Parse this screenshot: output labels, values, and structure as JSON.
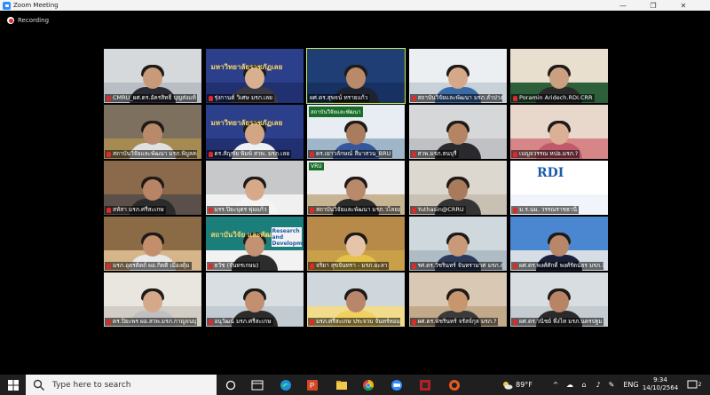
{
  "window": {
    "title": "Zoom Meeting",
    "controls": [
      "—",
      "❐",
      "✕"
    ]
  },
  "recording": {
    "label": "Recording",
    "dot_color": "#e02828"
  },
  "gallery": {
    "active_color": "#c9f04a",
    "tiles": [
      {
        "name": "CMRU_ผศ.ดร.อัครสิทธิ์ บุญส่งแท้",
        "bg_top": "#d6d9dc",
        "bg_bot": "#b9bec4",
        "skin": "#c99a7a",
        "shirt": "#2b2b36",
        "muted": true
      },
      {
        "name": "รุ่งกานต์ วิเศษ มรภ.เลย",
        "bg_top": "#2c3f8a",
        "bg_bot": "#203070",
        "skin": "#d8b090",
        "shirt": "#3a3a44",
        "muted": true,
        "banner": "มหาวิทยาลัยราชภัฏเลย"
      },
      {
        "name": "ผศ.ดร.สุพจน์ ทรายแก้ว",
        "bg_top": "#1e3e75",
        "bg_bot": "#173262",
        "skin": "#b98a6a",
        "shirt": "#1d2330",
        "muted": false,
        "active": true
      },
      {
        "name": "สถาบันวิจัยและพัฒนา มรภ.ลำปาง",
        "bg_top": "#eceff1",
        "bg_bot": "#c8d0d8",
        "skin": "#d5a888",
        "shirt": "#3a6aa8",
        "muted": true
      },
      {
        "name": "Poramin Aridech.RDI.CRR",
        "bg_top": "#e8dfcf",
        "bg_bot": "#2c5f3a",
        "skin": "#caa080",
        "shirt": "#2a2a2a",
        "muted": true
      },
      {
        "name": "สถาบันวิจัยและพัฒนา มรภ.พิบูลสงคราม",
        "bg_top": "#7d705f",
        "bg_bot": "#a58a52",
        "skin": "#b98a6a",
        "shirt": "#e0e0e0",
        "muted": true
      },
      {
        "name": "ดร.สัญชัย พิมพ์ สวพ. มรภ.เลย",
        "bg_top": "#2c3f8a",
        "bg_bot": "#203070",
        "skin": "#d2a684",
        "shirt": "#eceff4",
        "muted": true,
        "banner": "มหาวิทยาลัยราชภัฏเลย"
      },
      {
        "name": "ดร.เยาวลักษณ์ สีมาสวน_BRU",
        "bg_top": "#e7edf2",
        "bg_bot": "#9fb6c9",
        "skin": "#a87c5c",
        "shirt": "#36589a",
        "muted": true,
        "sign": "สถาบันวิจัยและพัฒนา"
      },
      {
        "name": "สวพ.มรภ.ธนบุรี",
        "bg_top": "#d6d7d9",
        "bg_bot": "#bfc1c4",
        "skin": "#b58464",
        "shirt": "#2a2a2e",
        "muted": true
      },
      {
        "name": "เบญจวรรณ หปอ.มรภ.?",
        "bg_top": "#e8d8cc",
        "bg_bot": "#d68686",
        "skin": "#dcb096",
        "shirt": "#c05a6a",
        "muted": true
      },
      {
        "name": "สหัสา มรภ.ศรีสะเกษ",
        "bg_top": "#8a6a4a",
        "bg_bot": "#5b4f49",
        "skin": "#b88466",
        "shirt": "#2b2b2b",
        "muted": true
      },
      {
        "name": "มรร.ปิยะบุตร พุ่มแก้ว",
        "bg_top": "#c7c8c9",
        "bg_bot": "#f0f0f0",
        "skin": "#d6a98a",
        "shirt": "#f4f4f4",
        "muted": true
      },
      {
        "name": "สถาบันวิจัยและพัฒนา มรภ.วไลยอลงกรณ์",
        "bg_top": "#eeeeee",
        "bg_bot": "#c7b493",
        "skin": "#b88a6a",
        "shirt": "#2b2b2b",
        "muted": true,
        "sign": "VRU"
      },
      {
        "name": "Yuthasin@CRRU",
        "bg_top": "#dcd7cf",
        "bg_bot": "#c9c0b4",
        "skin": "#a97a5b",
        "shirt": "#343434",
        "muted": true
      },
      {
        "name": "ม.ร.นม. วรรณราชธานี",
        "bg_top": "#ffffff",
        "bg_bot": "#f1f5fb",
        "skin": "#ffffff",
        "shirt": "#ffffff",
        "muted": true,
        "logo": "RDI"
      },
      {
        "name": "มรภ.อุตรดิตถ์ ผอ.กิตติ เมืองตุ้ม",
        "bg_top": "#8a6b45",
        "bg_bot": "#d7b58a",
        "skin": "#c28e6c",
        "shirt": "#e9e9e9",
        "muted": true
      },
      {
        "name": "ธวัช (จันทรเกษม)",
        "bg_top": "#1c7e7a",
        "bg_bot": "#f2f2f2",
        "skin": "#c29272",
        "shirt": "#2c2c2c",
        "muted": true,
        "banner": "สถาบันวิจัย และพัฒนา",
        "card": "Research and Development"
      },
      {
        "name": "จริยา สุขจันทรา - มรภ.ยะลา",
        "bg_top": "#b88a4a",
        "bg_bot": "#c8a04a",
        "skin": "#e6c4a8",
        "shirt": "#e4c24a",
        "muted": true
      },
      {
        "name": "รศ.ดร.วัชรินทร์ จันทรามาศ มรภ.สวนสุนันทา",
        "bg_top": "#cfd8dc",
        "bg_bot": "#b0bcc4",
        "skin": "#c99a7a",
        "shirt": "#2b3a5a",
        "muted": true
      },
      {
        "name": "ผศ.ดร.พงศ์ศักดิ์ พงศ์รัตน์ธร มรภ.?",
        "bg_top": "#4b86d0",
        "bg_bot": "#d7dde5",
        "skin": "#b8876a",
        "shirt": "#1a1f3a",
        "muted": true
      },
      {
        "name": "ดร.ปิยะพร ผอ.สวพ.มรภ.กาญจนบุรี",
        "bg_top": "#e9e5df",
        "bg_bot": "#d1ccc4",
        "skin": "#d4a888",
        "shirt": "#c0c0c0",
        "muted": true
      },
      {
        "name": "อนุวัฒน์ มรภ.ศรีสะเกษ",
        "bg_top": "#d9dee3",
        "bg_bot": "#c2cad2",
        "skin": "#c29070",
        "shirt": "#2b2b2b",
        "muted": true
      },
      {
        "name": "มรภ.ศรีสะเกษ ประจวบ จันทร์หอม",
        "bg_top": "#cfd6dc",
        "bg_bot": "#f0dc8a",
        "skin": "#b8866a",
        "shirt": "#f0d060",
        "muted": true
      },
      {
        "name": "ผศ.ดร.พัชรินทร์ จรัสจ์กุล มรภ.?",
        "bg_top": "#d9c8b3",
        "bg_bot": "#c2a98a",
        "skin": "#c8966e",
        "shirt": "#3a3a3a",
        "muted": true
      },
      {
        "name": "ผศ.ดร.วนิชย์ พึ่งไท มรภ.นครปฐม",
        "bg_top": "#d8dde1",
        "bg_bot": "#c4cbd1",
        "skin": "#b88466",
        "shirt": "#2a2a2a",
        "muted": true
      }
    ]
  },
  "taskbar": {
    "search_placeholder": "Type here to search",
    "apps": [
      "start-icon",
      "task-view-icon",
      "widgets-icon",
      "edge-icon",
      "powerpoint-icon",
      "file-explorer-icon",
      "chrome-icon",
      "zoom-icon",
      "app-icon",
      "browser-icon"
    ],
    "weather": "89°F",
    "language": "ENG",
    "time": "9:34",
    "date": "14/10/2564",
    "notifications": "2"
  }
}
